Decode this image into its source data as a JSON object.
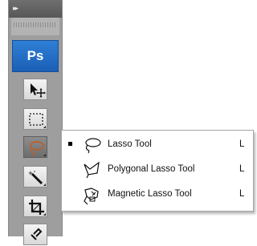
{
  "panel": {
    "collapse_glyph": "▸▸",
    "logo": "Ps",
    "tools": [
      {
        "name": "move-tool",
        "icon": "move-arrow-icon"
      },
      {
        "name": "rectangular-marquee-tool",
        "icon": "marquee-icon"
      },
      {
        "name": "lasso-tool",
        "icon": "lasso-icon",
        "active": true
      },
      {
        "name": "quick-selection-tool",
        "icon": "magic-wand-icon"
      },
      {
        "name": "crop-tool",
        "icon": "crop-icon"
      },
      {
        "name": "eyedropper-tool",
        "icon": "eyedropper-icon"
      }
    ]
  },
  "flyout": {
    "items": [
      {
        "label": "Lasso Tool",
        "shortcut": "L",
        "selected": true,
        "icon": "lasso-icon"
      },
      {
        "label": "Polygonal Lasso Tool",
        "shortcut": "L",
        "selected": false,
        "icon": "polygonal-lasso-icon"
      },
      {
        "label": "Magnetic Lasso Tool",
        "shortcut": "L",
        "selected": false,
        "icon": "magnetic-lasso-icon"
      }
    ]
  }
}
